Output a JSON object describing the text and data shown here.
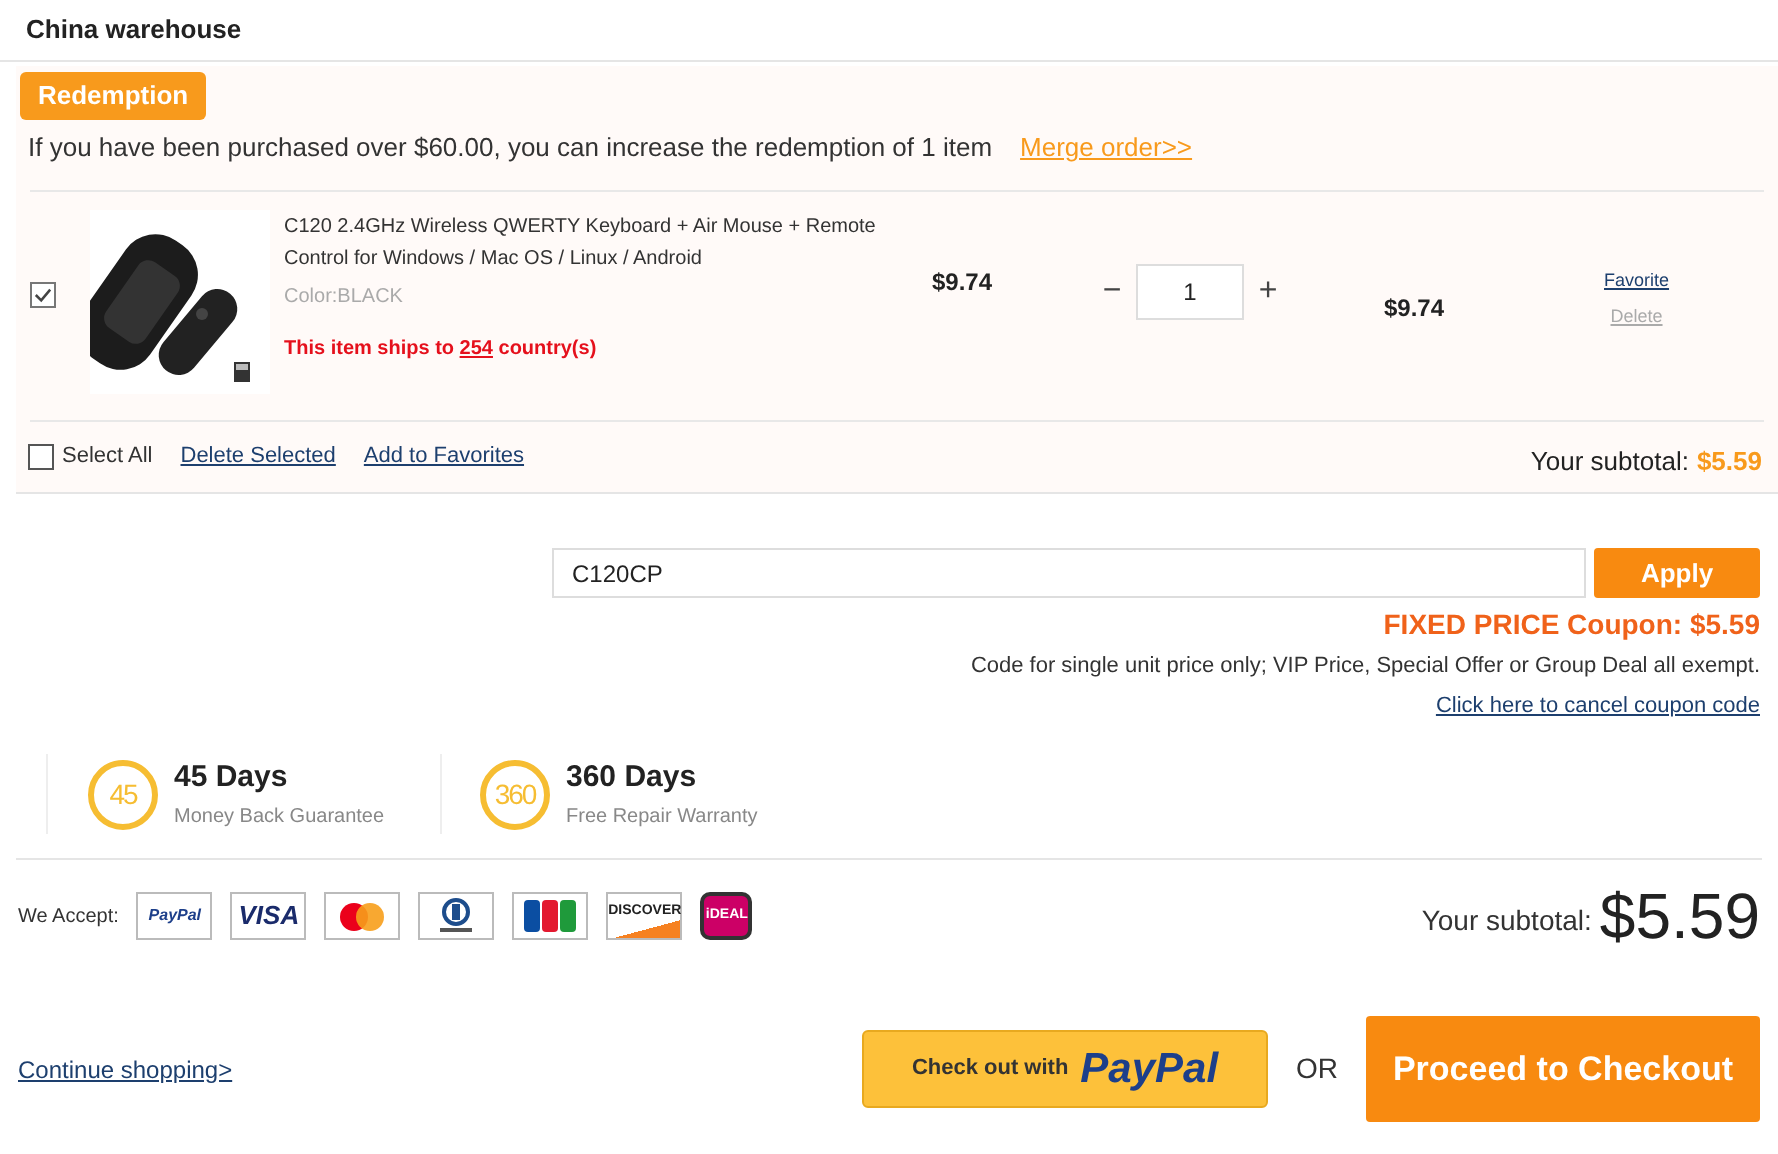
{
  "warehouse": {
    "title": "China warehouse"
  },
  "redemption": {
    "badge": "Redemption",
    "message": "If you have been purchased over $60.00, you can increase the redemption of 1 item",
    "link": "Merge order>>"
  },
  "items": [
    {
      "checked": true,
      "title": "C120 2.4GHz Wireless QWERTY Keyboard + Air Mouse + Remote Control for Windows / Mac OS / Linux / Android",
      "variant": "Color:BLACK",
      "ships": "This item ships to **254** country(s)",
      "price": "$9.74",
      "minus": "−",
      "quantity": "1",
      "plus": "+",
      "total": "$9.74",
      "favorite": "Favorite",
      "delete": "Delete"
    }
  ],
  "cart_footer": {
    "select_all": {
      "label": "Select All",
      "checked": false
    },
    "delete_selected": "Delete Selected",
    "add_to_favorites": "Add to Favorites",
    "subtotal_label": "Your subtotal:",
    "subtotal": "$5.59"
  },
  "coupon": {
    "value": "C120CP",
    "apply": "Apply",
    "result": "FIXED PRICE Coupon: $5.59",
    "note": "Code for single unit price only; VIP Price, Special Offer or Group Deal all exempt.",
    "cancel": "Click here to cancel coupon code"
  },
  "guarantees": [
    {
      "badge": "45",
      "title": "45 Days",
      "subtitle": "Money Back Guarantee"
    },
    {
      "badge": "360",
      "title": "360 Days",
      "subtitle": "Free Repair Warranty"
    }
  ],
  "payment": {
    "label": "We Accept:",
    "methods": [
      {
        "kind": "paypal",
        "label": "PayPal"
      },
      {
        "kind": "visa",
        "label": "VISA"
      },
      {
        "kind": "mastercard"
      },
      {
        "kind": "diners"
      },
      {
        "kind": "jcb"
      },
      {
        "kind": "discover",
        "label": "DISCOVER"
      },
      {
        "kind": "ideal",
        "label": "iDEAL"
      }
    ]
  },
  "summary": {
    "subtotal_label": "Your subtotal:",
    "subtotal": "$5.59"
  },
  "actions": {
    "continue": "Continue shopping>",
    "paypal_prefix": "Check out with",
    "paypal_brand": "PayPal",
    "or": "OR",
    "checkout": "Proceed to Checkout"
  }
}
